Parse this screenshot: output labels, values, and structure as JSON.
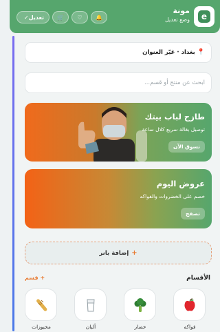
{
  "header": {
    "app_name": "مونة",
    "mode_label": "وضع تعديل",
    "logo_letter": "e",
    "edit_button": "تعديل",
    "edit_check": "✓",
    "cart_icon": "🛒",
    "heart_icon": "♡",
    "bell_icon": "🔔"
  },
  "address": {
    "pin": "📍",
    "text": "بغداد · غيّر العنوان"
  },
  "search": {
    "placeholder": "ابحث عن منتج أو قسم..."
  },
  "banners": [
    {
      "title": "طازج لباب بيتك",
      "subtitle": "توصيل بقالة سريع كلال ساعة",
      "button": "تسوق الآن"
    },
    {
      "title": "عروض اليوم",
      "subtitle": "خصم على الخضروات والفواكه",
      "button": "تصفح"
    }
  ],
  "add_banner": {
    "plus": "+",
    "label": "إضافة بانر"
  },
  "categories_section": {
    "title": "الأقسام",
    "add_label": "+ قسم",
    "items": [
      {
        "label": "فواكه",
        "icon": "apple-icon"
      },
      {
        "label": "خضار",
        "icon": "broccoli-icon"
      },
      {
        "label": "ألبان",
        "icon": "milk-icon"
      },
      {
        "label": "مخبوزات",
        "icon": "bread-icon"
      }
    ]
  },
  "colors": {
    "primary": "#56a66d",
    "accent": "#e8792f",
    "background": "#eef2f3"
  }
}
